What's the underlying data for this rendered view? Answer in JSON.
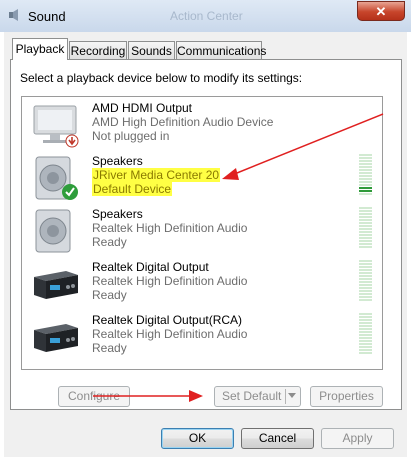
{
  "window": {
    "title": "Sound",
    "background_title": "Action Center",
    "close_label": "✕"
  },
  "tabs": [
    {
      "label": "Playback",
      "active": true
    },
    {
      "label": "Recording",
      "active": false
    },
    {
      "label": "Sounds",
      "active": false
    },
    {
      "label": "Communications",
      "active": false
    }
  ],
  "instruction": "Select a playback device below to modify its settings:",
  "devices": [
    {
      "name": "AMD HDMI Output",
      "line2": "AMD High Definition Audio Device",
      "status": "Not plugged in",
      "icon": "monitor-icon",
      "badge": "unplugged-badge-icon"
    },
    {
      "name": "Speakers",
      "line2": "JRiver Media Center 20",
      "status": "Default Device",
      "icon": "speaker-icon",
      "badge": "default-check-icon",
      "level": 0.1
    },
    {
      "name": "Speakers",
      "line2": "Realtek High Definition Audio",
      "status": "Ready",
      "icon": "speaker-icon",
      "level": 0
    },
    {
      "name": "Realtek Digital Output",
      "line2": "Realtek High Definition Audio",
      "status": "Ready",
      "icon": "digital-output-icon",
      "level": 0
    },
    {
      "name": "Realtek Digital Output(RCA)",
      "line2": "Realtek High Definition Audio",
      "status": "Ready",
      "icon": "digital-output-icon",
      "level": 0
    }
  ],
  "buttons": {
    "configure": "Configure",
    "set_default": "Set Default",
    "properties": "Properties",
    "ok": "OK",
    "cancel": "Cancel",
    "apply": "Apply"
  },
  "colors": {
    "highlight": "#ffff44",
    "annotation_arrow": "#e02020",
    "meter_active": "#2f9a3a"
  }
}
